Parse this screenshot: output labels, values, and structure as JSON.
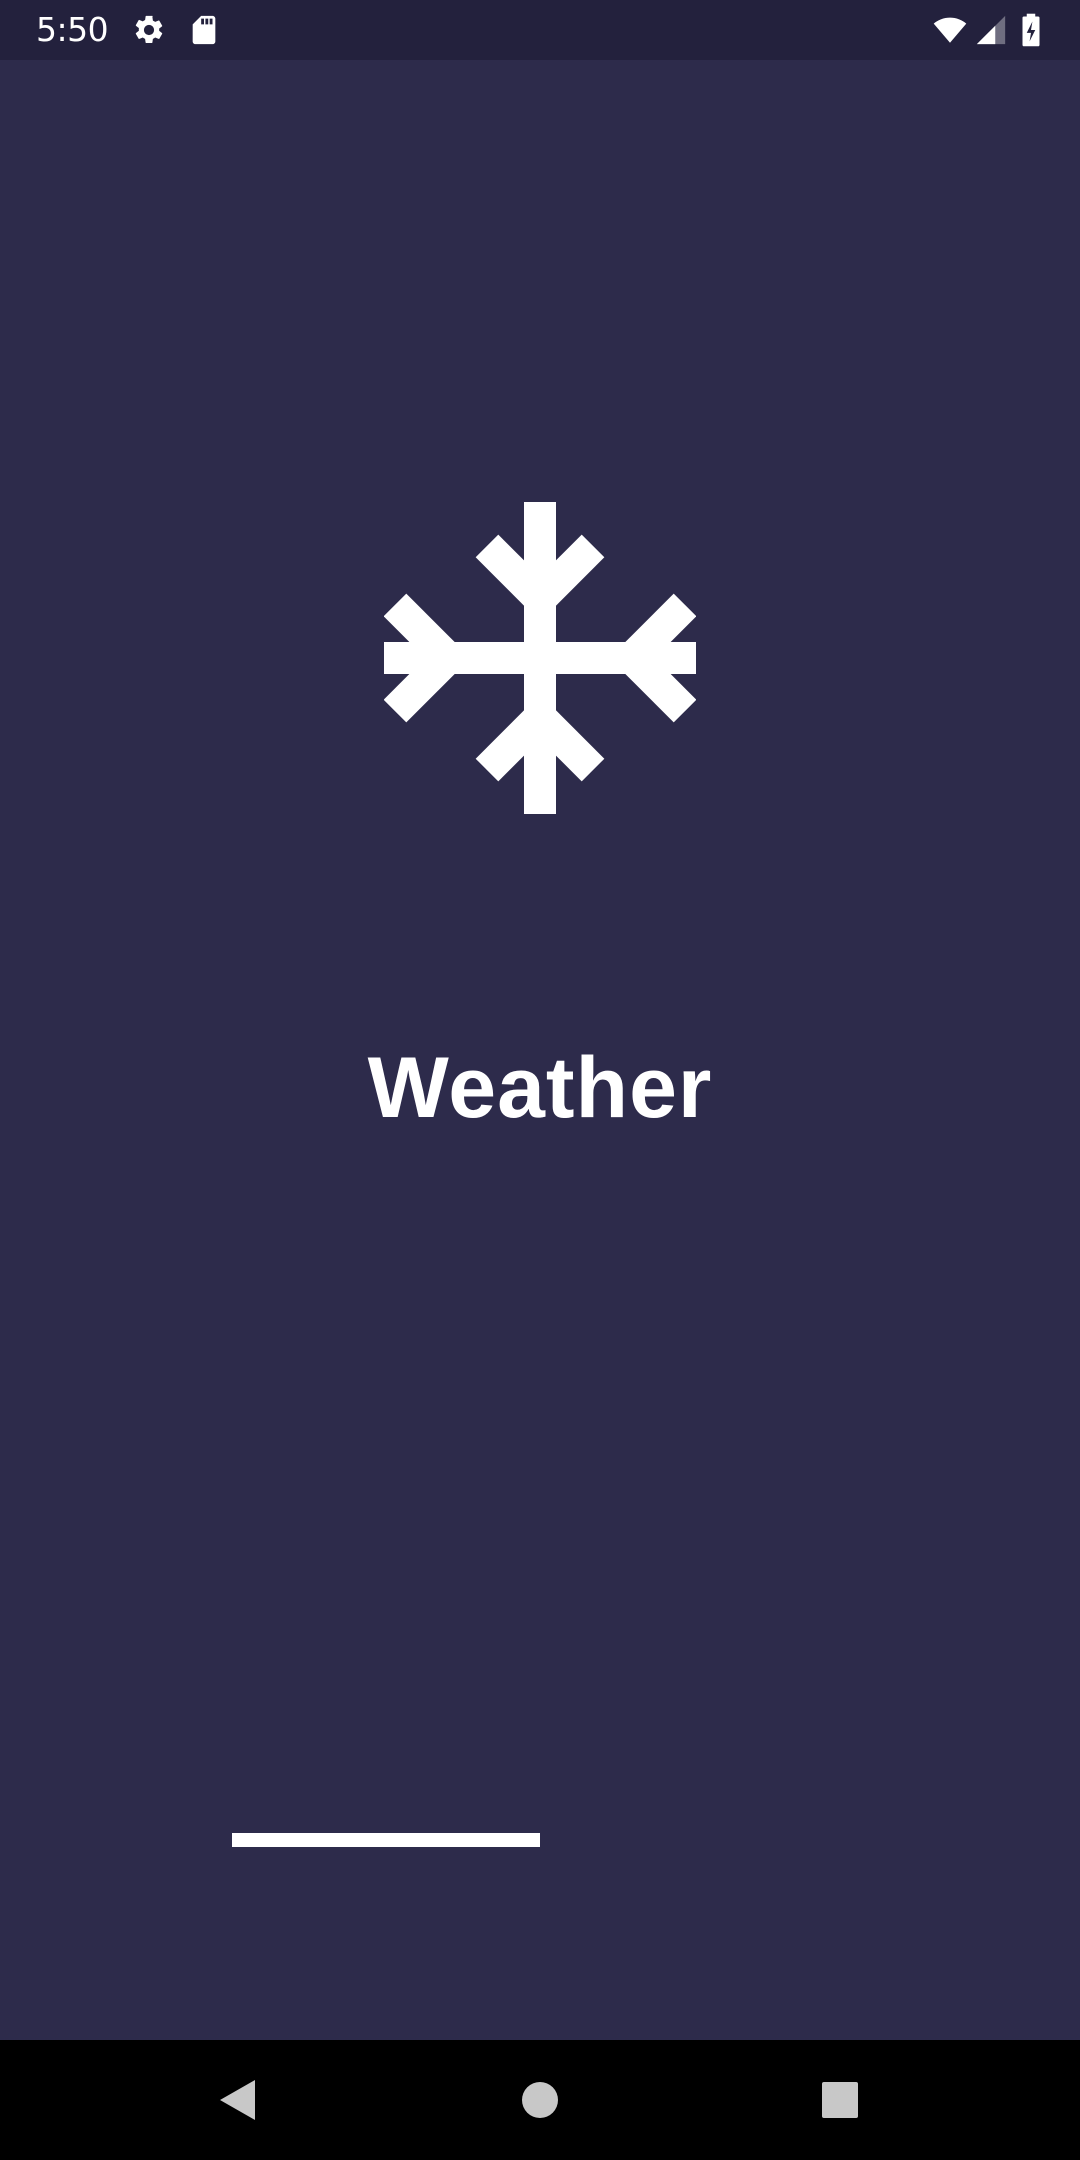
{
  "status_bar": {
    "time": "5:50",
    "icons": [
      "gear-icon",
      "sd-card-icon",
      "wifi-icon",
      "signal-icon",
      "battery-charging-icon"
    ]
  },
  "splash": {
    "logo_icon": "snowflake-icon",
    "title": "Weather",
    "loading_progress": 0.5
  },
  "nav_bar": {
    "buttons": [
      "back-icon",
      "home-icon",
      "recents-icon"
    ]
  },
  "colors": {
    "background": "#2d2b4b",
    "status_bar": "#23213d",
    "nav_bar": "#000000",
    "foreground": "#ffffff"
  }
}
